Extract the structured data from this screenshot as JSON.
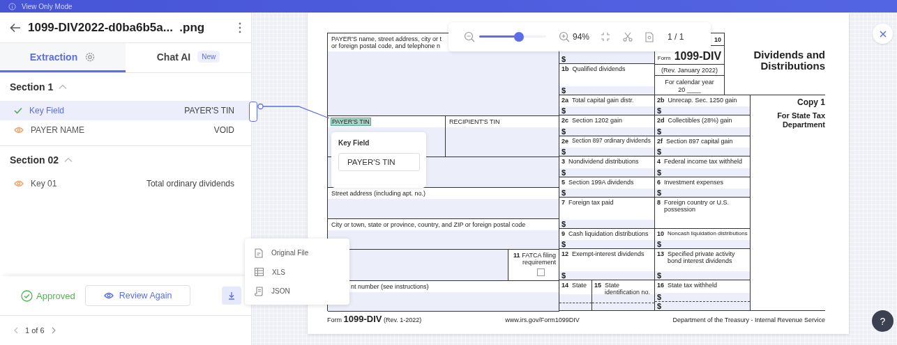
{
  "top_bar": {
    "notice": "View Only Mode"
  },
  "file": {
    "title": "1099-DIV2022-d0ba6b5a...  .png"
  },
  "tabs": [
    {
      "label": "Extraction",
      "selected": true,
      "kind": "settings"
    },
    {
      "label": "Chat AI",
      "selected": false,
      "kind": "badge",
      "badge": "New"
    }
  ],
  "sections": [
    {
      "title": "Section 1",
      "expanded": true,
      "items": [
        {
          "label": "Key Field",
          "value": "PAYER'S TIN",
          "approved": true,
          "selected": true
        },
        {
          "label": "PAYER NAME",
          "value": "VOID",
          "approved": false,
          "selected": false
        }
      ]
    },
    {
      "title": "Section 02",
      "expanded": true,
      "items": [
        {
          "label": "Key 01",
          "value": "Total ordinary dividends",
          "approved": false,
          "selected": false
        }
      ]
    }
  ],
  "footer": {
    "status": "Approved",
    "review_button": "Review Again"
  },
  "pagination": {
    "label": "1 of 6"
  },
  "export_menu": [
    {
      "kind": "file",
      "label": "Original File"
    },
    {
      "kind": "table",
      "label": "XLS"
    },
    {
      "kind": "json",
      "label": "JSON"
    }
  ],
  "toolbar": {
    "level": 0.59,
    "zoom": "94%",
    "page": "1 / 1"
  },
  "key_popup": {
    "title": "Key Field",
    "value": "PAYER'S TIN"
  },
  "help_button": "?",
  "document": {
    "payer_lines": [
      "PAYER'S name, street address, city or t",
      "or foreign postal code, and telephone n"
    ],
    "tins": [
      {
        "label": "PAYER'S TIN",
        "highlighted": true
      },
      {
        "label": "RECIPIENT'S TIN",
        "highlighted": false
      }
    ],
    "rows": [
      {
        "kind": "field"
      },
      {
        "kind": "field",
        "label": "Street address (including apt. no.)"
      },
      {
        "kind": "field",
        "label": "City or town, state or province, country, and ZIP or foreign postal code"
      },
      {
        "kind": "fatca",
        "num": "11",
        "label": "FATCA filing requirement",
        "checked": false
      },
      {
        "kind": "field",
        "label": "nt number (see instructions)"
      }
    ],
    "form_id": {
      "omb": "10",
      "name": "Form **1099-DIV**",
      "rev": "(Rev. January 2022)",
      "year_label": "For calendar year",
      "year": "20 ____"
    },
    "title": "Dividends and Distributions",
    "copy": {
      "title": "Copy 1",
      "subtitle": "For State Tax Department"
    },
    "boxes": [
      {
        "kind": "amount",
        "amounts": [
          "$"
        ]
      },
      {
        "kind": "amount",
        "num": "1b",
        "label": "Qualified dividends",
        "amounts": [
          "$"
        ]
      },
      {
        "kind": "amount",
        "num": "2a",
        "label": "Total capital gain distr.",
        "amounts": [
          "$"
        ]
      },
      {
        "kind": "amount",
        "num": "2b",
        "label": "Unrecap. Sec. 1250 gain",
        "amounts": [
          "$"
        ]
      },
      {
        "kind": "amount",
        "num": "2c",
        "label": "Section 1202 gain",
        "amounts": [
          "$"
        ]
      },
      {
        "kind": "amount",
        "num": "2d",
        "label": "Collectibles (28%) gain",
        "amounts": [
          "$"
        ]
      },
      {
        "kind": "amount",
        "num": "2e",
        "label": "Section 897 ordinary dividends",
        "amounts": [
          "$"
        ]
      },
      {
        "kind": "amount",
        "num": "2f",
        "label": "Section 897 capital gain",
        "amounts": [
          "$"
        ]
      },
      {
        "kind": "amount",
        "num": "3",
        "label": "Nondividend distributions",
        "amounts": [
          "$"
        ]
      },
      {
        "kind": "amount",
        "num": "4",
        "label": "Federal income tax withheld",
        "amounts": [
          "$"
        ]
      },
      {
        "kind": "amount",
        "num": "5",
        "label": "Section 199A dividends",
        "amounts": [
          "$"
        ]
      },
      {
        "kind": "amount",
        "num": "6",
        "label": "Investment expenses",
        "amounts": [
          "$"
        ]
      },
      {
        "kind": "amount",
        "num": "7",
        "label": "Foreign tax paid",
        "amounts": [
          "$"
        ]
      },
      {
        "kind": "amount",
        "num": "8",
        "label": "Foreign country or U.S. possession"
      },
      {
        "kind": "amount",
        "num": "9",
        "label": "Cash liquidation distributions",
        "amounts": [
          "$"
        ]
      },
      {
        "kind": "amount",
        "num": "10",
        "label": "Noncash liquidation distributions",
        "amounts": [
          "$"
        ]
      },
      {
        "kind": "amount",
        "num": "12",
        "label": "Exempt-interest dividends",
        "amounts": [
          "$"
        ]
      },
      {
        "kind": "amount",
        "num": "13",
        "label": "Specified private activity bond interest dividends",
        "amounts": [
          "$"
        ]
      },
      {
        "kind": "split",
        "parts": [
          {
            "num": "14",
            "label": "State"
          },
          {
            "num": "15",
            "label": "State identification no."
          }
        ]
      },
      {
        "kind": "amount",
        "num": "16",
        "label": "State tax withheld",
        "amounts": [
          "$",
          "$"
        ]
      }
    ],
    "footer": {
      "name": "Form **1099-DIV** (Rev. 1-2022)",
      "url": "www.irs.gov/Form1099DIV",
      "agency": "Department of the Treasury - Internal Revenue Service"
    }
  }
}
